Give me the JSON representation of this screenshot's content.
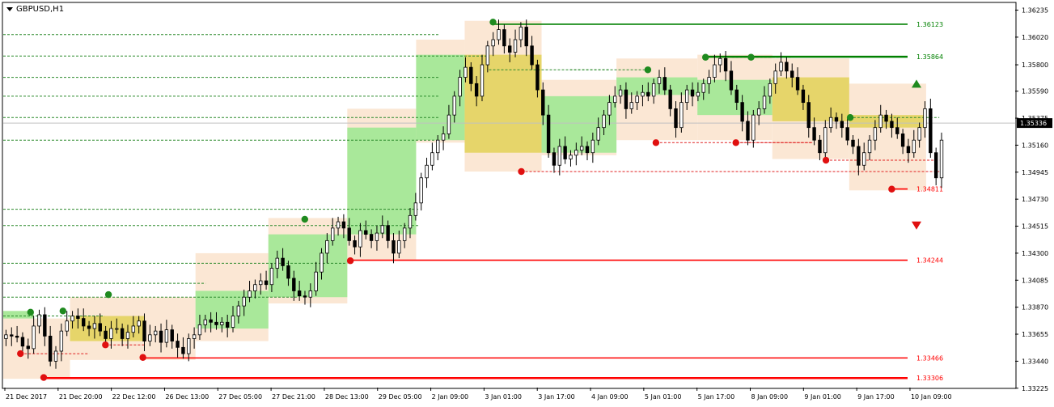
{
  "window": {
    "symbol_timeframe": "GBPUSD,H1"
  },
  "chart_data": {
    "type": "candlestick",
    "ylim": [
      1.3323,
      1.3629
    ],
    "y_ticks": [
      "1.36235",
      "1.36020",
      "1.35800",
      "1.35590",
      "1.35375",
      "1.35160",
      "1.34945",
      "1.34730",
      "1.34515",
      "1.34300",
      "1.34085",
      "1.33870",
      "1.33655",
      "1.33440",
      "1.33225"
    ],
    "x_ticks": [
      "21 Dec 2017",
      "21 Dec 20:00",
      "22 Dec 12:00",
      "26 Dec 13:00",
      "27 Dec 05:00",
      "27 Dec 21:00",
      "28 Dec 13:00",
      "29 Dec 05:00",
      "2 Jan 09:00",
      "3 Jan 01:00",
      "3 Jan 17:00",
      "4 Jan 09:00",
      "5 Jan 01:00",
      "5 Jan 17:00",
      "8 Jan 09:00",
      "9 Jan 01:00",
      "9 Jan 17:00",
      "10 Jan 09:00"
    ],
    "current_price": "1.35336",
    "closes": [
      1.3365,
      1.3364,
      1.3363,
      1.3356,
      1.3354,
      1.3372,
      1.3381,
      1.3364,
      1.3344,
      1.3352,
      1.3368,
      1.3376,
      1.338,
      1.3378,
      1.3372,
      1.337,
      1.3374,
      1.3368,
      1.3362,
      1.337,
      1.337,
      1.3362,
      1.3367,
      1.3372,
      1.3376,
      1.336,
      1.3365,
      1.3368,
      1.3359,
      1.3369,
      1.336,
      1.3355,
      1.335,
      1.3362,
      1.3365,
      1.3373,
      1.3377,
      1.3375,
      1.3373,
      1.3375,
      1.3371,
      1.338,
      1.3388,
      1.3395,
      1.34,
      1.3405,
      1.3408,
      1.3405,
      1.3418,
      1.3426,
      1.342,
      1.341,
      1.34,
      1.3396,
      1.3395,
      1.34,
      1.3415,
      1.343,
      1.344,
      1.345,
      1.3455,
      1.345,
      1.344,
      1.3435,
      1.3448,
      1.3445,
      1.344,
      1.3446,
      1.3452,
      1.344,
      1.343,
      1.344,
      1.345,
      1.346,
      1.347,
      1.349,
      1.35,
      1.351,
      1.352,
      1.3525,
      1.354,
      1.3555,
      1.357,
      1.3578,
      1.3565,
      1.3555,
      1.358,
      1.3595,
      1.36,
      1.3608,
      1.3595,
      1.359,
      1.36,
      1.361,
      1.3595,
      1.358,
      1.356,
      1.354,
      1.351,
      1.35,
      1.3515,
      1.3505,
      1.3508,
      1.3512,
      1.3515,
      1.351,
      1.352,
      1.353,
      1.354,
      1.355,
      1.3555,
      1.356,
      1.3545,
      1.355,
      1.3555,
      1.3558,
      1.3555,
      1.3565,
      1.357,
      1.356,
      1.3545,
      1.353,
      1.355,
      1.356,
      1.3555,
      1.3558,
      1.3565,
      1.357,
      1.358,
      1.3585,
      1.3575,
      1.356,
      1.355,
      1.3535,
      1.352,
      1.354,
      1.3545,
      1.3555,
      1.3565,
      1.3575,
      1.3582,
      1.3575,
      1.357,
      1.356,
      1.355,
      1.353,
      1.352,
      1.351,
      1.353,
      1.3538,
      1.3535,
      1.353,
      1.352,
      1.3515,
      1.35,
      1.351,
      1.352,
      1.353,
      1.354,
      1.3535,
      1.353,
      1.3525,
      1.3515,
      1.351,
      1.352,
      1.353,
      1.3545,
      1.351,
      1.349,
      1.352
    ],
    "levels": [
      {
        "label": "1.36123",
        "value": 1.36123,
        "color": "#008000"
      },
      {
        "label": "1.35864",
        "value": 1.35864,
        "color": "#008000"
      },
      {
        "label": "1.34811",
        "value": 1.34811,
        "color": "#ff0000"
      },
      {
        "label": "1.34244",
        "value": 1.34244,
        "color": "#ff0000"
      },
      {
        "label": "1.33466",
        "value": 1.33466,
        "color": "#ff0000"
      },
      {
        "label": "1.33306",
        "value": 1.33306,
        "color": "#ff0000"
      }
    ],
    "zones": [
      {
        "x0": 0.0,
        "x1": 0.03,
        "y0": 1.3378,
        "y1": 1.3384,
        "color": "#a9e89a"
      },
      {
        "x0": 0.0,
        "x1": 0.066,
        "y0": 1.333,
        "y1": 1.3378,
        "color": "#fbe7d4"
      },
      {
        "x0": 0.066,
        "x1": 0.14,
        "y0": 1.336,
        "y1": 1.338,
        "color": "#e6d56a"
      },
      {
        "x0": 0.066,
        "x1": 0.19,
        "y0": 1.3345,
        "y1": 1.3395,
        "color": "#fbe7d4"
      },
      {
        "x0": 0.19,
        "x1": 0.262,
        "y0": 1.337,
        "y1": 1.34,
        "color": "#a9e89a"
      },
      {
        "x0": 0.19,
        "x1": 0.262,
        "y0": 1.336,
        "y1": 1.343,
        "color": "#fbe7d4"
      },
      {
        "x0": 0.262,
        "x1": 0.34,
        "y0": 1.3395,
        "y1": 1.3445,
        "color": "#a9e89a"
      },
      {
        "x0": 0.262,
        "x1": 0.34,
        "y0": 1.339,
        "y1": 1.3458,
        "color": "#fbe7d4"
      },
      {
        "x0": 0.34,
        "x1": 0.408,
        "y0": 1.3445,
        "y1": 1.353,
        "color": "#a9e89a"
      },
      {
        "x0": 0.34,
        "x1": 0.408,
        "y0": 1.3425,
        "y1": 1.3545,
        "color": "#fbe7d4"
      },
      {
        "x0": 0.408,
        "x1": 0.456,
        "y0": 1.352,
        "y1": 1.3588,
        "color": "#a9e89a"
      },
      {
        "x0": 0.408,
        "x1": 0.456,
        "y0": 1.3518,
        "y1": 1.36,
        "color": "#fbe7d4"
      },
      {
        "x0": 0.456,
        "x1": 0.532,
        "y0": 1.351,
        "y1": 1.3588,
        "color": "#e6d56a"
      },
      {
        "x0": 0.456,
        "x1": 0.532,
        "y0": 1.3495,
        "y1": 1.3615,
        "color": "#fbe7d4"
      },
      {
        "x0": 0.532,
        "x1": 0.606,
        "y0": 1.351,
        "y1": 1.3555,
        "color": "#a9e89a"
      },
      {
        "x0": 0.532,
        "x1": 0.606,
        "y0": 1.3508,
        "y1": 1.3568,
        "color": "#fbe7d4"
      },
      {
        "x0": 0.606,
        "x1": 0.686,
        "y0": 1.3556,
        "y1": 1.357,
        "color": "#a9e89a"
      },
      {
        "x0": 0.606,
        "x1": 0.686,
        "y0": 1.352,
        "y1": 1.3585,
        "color": "#fbe7d4"
      },
      {
        "x0": 0.686,
        "x1": 0.76,
        "y0": 1.354,
        "y1": 1.3568,
        "color": "#a9e89a"
      },
      {
        "x0": 0.686,
        "x1": 0.76,
        "y0": 1.352,
        "y1": 1.3588,
        "color": "#fbe7d4"
      },
      {
        "x0": 0.76,
        "x1": 0.836,
        "y0": 1.3535,
        "y1": 1.357,
        "color": "#e6d56a"
      },
      {
        "x0": 0.76,
        "x1": 0.836,
        "y0": 1.3505,
        "y1": 1.3585,
        "color": "#fbe7d4"
      },
      {
        "x0": 0.836,
        "x1": 0.912,
        "y0": 1.353,
        "y1": 1.354,
        "color": "#e6d56a"
      },
      {
        "x0": 0.836,
        "x1": 0.912,
        "y0": 1.348,
        "y1": 1.3565,
        "color": "#fbe7d4"
      }
    ],
    "highs": [
      {
        "x": 0.027,
        "v": 1.3383
      },
      {
        "x": 0.059,
        "v": 1.3384
      },
      {
        "x": 0.104,
        "v": 1.3397
      },
      {
        "x": 0.298,
        "v": 1.3457
      },
      {
        "x": 0.484,
        "v": 1.3614
      },
      {
        "x": 0.637,
        "v": 1.3576
      },
      {
        "x": 0.694,
        "v": 1.3586
      },
      {
        "x": 0.739,
        "v": 1.3586
      },
      {
        "x": 0.837,
        "v": 1.3538
      }
    ],
    "lows": [
      {
        "x": 0.017,
        "v": 1.335
      },
      {
        "x": 0.04,
        "v": 1.3331
      },
      {
        "x": 0.101,
        "v": 1.3357
      },
      {
        "x": 0.138,
        "v": 1.3347
      },
      {
        "x": 0.343,
        "v": 1.3424
      },
      {
        "x": 0.512,
        "v": 1.3495
      },
      {
        "x": 0.645,
        "v": 1.3518
      },
      {
        "x": 0.724,
        "v": 1.3518
      },
      {
        "x": 0.813,
        "v": 1.3504
      },
      {
        "x": 0.878,
        "v": 1.3481
      }
    ]
  }
}
